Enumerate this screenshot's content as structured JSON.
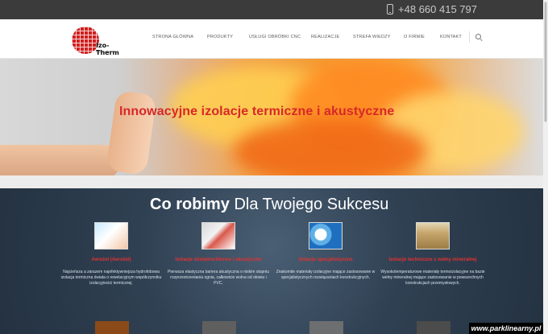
{
  "topbar": {
    "phone": "+48 660 415 797"
  },
  "logo": {
    "brand": "Izo-Therm",
    "url": "www.izo-therm.pl"
  },
  "menu": [
    "STRONA GŁÓWNA",
    "PRODUKTY",
    "USŁUGI OBRÓBKI CNC",
    "REALIZACJE",
    "STREFA WIEDZY",
    "O FIRMIE",
    "KONTAKT"
  ],
  "hero": {
    "title": "Innowacyjne izolacje termiczne i akustyczne"
  },
  "section": {
    "title_bold": "Co robimy",
    "title_rest": " Dla Twojego Sukcesu"
  },
  "items": [
    {
      "title": "Aerożel (Aerożel)",
      "text": "Najcieńsza a zarazem najefektywniejsza hydrofobowa izolacja termiczna świata o rewelacyjnym współczynniku izolacyjności termicznej."
    },
    {
      "title": "Izolacje dźwiękochłonne i akustyczne",
      "text": "Pierwsza elastyczna bariera akustyczna o niskim stopniu rozprzestrzeniania ognia, całkowicie wolna od ołowiu i PVC."
    },
    {
      "title": "Izolacje specjalistyczne",
      "text": "Znakomite materiały izolacyjne mające zastosowanie w specjalistycznych rozwiązaniach konstrukcyjnych."
    },
    {
      "title": "Izolacje techniczne z wełny mineralnej",
      "text": "Wysokotemperaturowe materiały termoizolacyjne na bazie wełny mineralnej mające zastosowanie w powszechnych konstrukcjach przemysłowych."
    }
  ],
  "watermark": "www.parklinearny.pl",
  "colors": {
    "accent_red": "#d72828",
    "topbar": "#3b3b3b",
    "section_bg": "#304153"
  },
  "icons": {
    "phone": "phone-icon",
    "search": "search-icon"
  }
}
